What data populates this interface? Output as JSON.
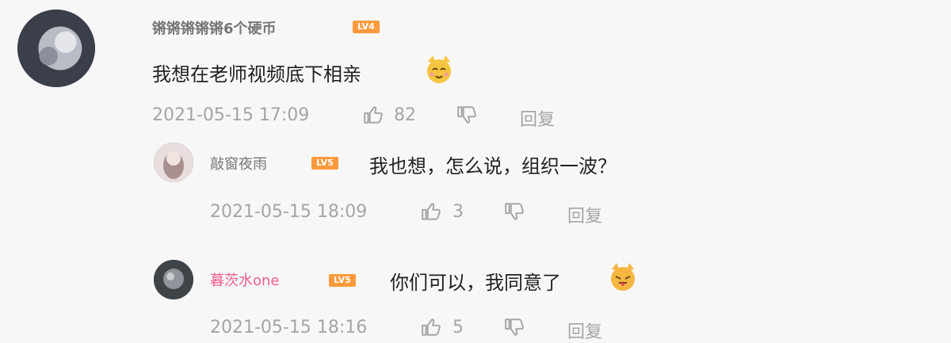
{
  "comments": [
    {
      "username": "锵锵锵锵锵6个硬币",
      "level": "LV4",
      "text": "我想在老师视频底下相亲",
      "emoji": "cat-face-emoji",
      "timestamp": "2021-05-15 17:09",
      "likes": "82",
      "reply_label": "回复"
    }
  ],
  "replies": [
    {
      "username": "敲窗夜雨",
      "level": "LV5",
      "text": "我也想，怎么说，组织一波？",
      "timestamp": "2021-05-15 18:09",
      "likes": "3",
      "reply_label": "回复"
    },
    {
      "username": "暮茨水one",
      "level": "LV5",
      "text": "你们可以，我同意了",
      "emoji": "tongue-cat-emoji",
      "timestamp": "2021-05-15 18:16",
      "likes": "5",
      "reply_label": "回复"
    }
  ],
  "colors": {
    "background": "#f7f7f7",
    "meta_text": "#a5a5a5",
    "username_pink": "#f25d8e",
    "level_badge": "#ff9a3c"
  }
}
